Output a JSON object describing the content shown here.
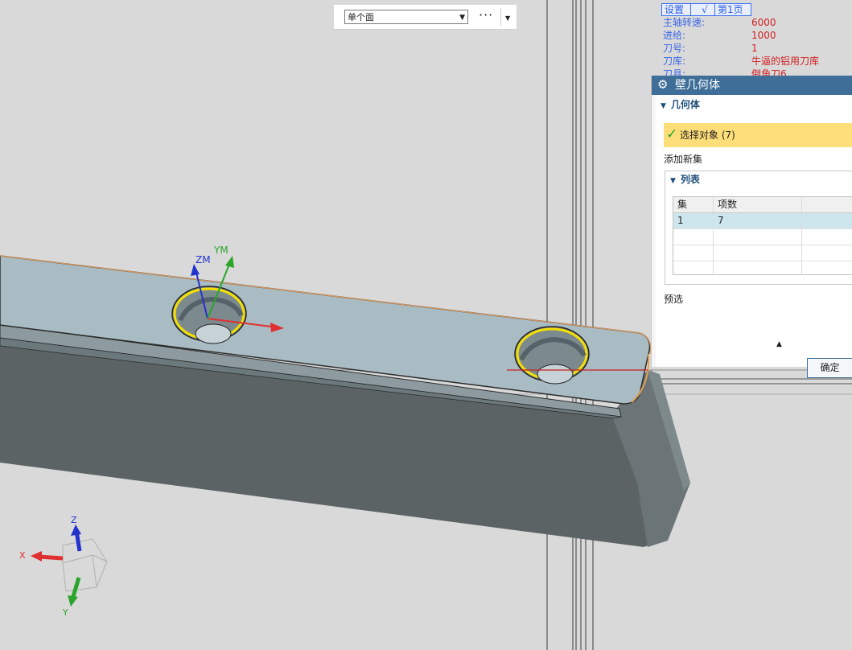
{
  "toolbar": {
    "filter_value": "单个面",
    "more_label": "···"
  },
  "info_panel": {
    "tabs": [
      "设置",
      "√",
      "第1页"
    ],
    "rows": [
      {
        "label": "主轴转速:",
        "value": "6000"
      },
      {
        "label": "进给:",
        "value": "1000"
      },
      {
        "label": "刀号:",
        "value": "1"
      },
      {
        "label": "刀库:",
        "value": "牛逼的铝用刀库"
      },
      {
        "label": "刀具:",
        "value": "倒角刀6"
      }
    ]
  },
  "dialog": {
    "title": "壁几何体",
    "geometry_section": "几何体",
    "select_object": "选择对象 (7)",
    "add_new_set": "添加新集",
    "list_section": "列表",
    "table": {
      "headers": [
        "集",
        "项数",
        ""
      ],
      "rows": [
        [
          "1",
          "7",
          ""
        ]
      ]
    },
    "preselect": "预选",
    "ok_label": "确定"
  },
  "viewport": {
    "wcs_labels": {
      "zm": "ZM",
      "ym": "YM"
    },
    "triad_labels": {
      "x": "X",
      "y": "Y",
      "z": "Z"
    }
  },
  "colors": {
    "dialog_header": "#3f6e98",
    "selection_highlight": "#fede78",
    "part_top": "#a9bcc4",
    "part_side": "#5b6364",
    "hole_edge": "#f5e000",
    "tab_border": "#3a6ff0",
    "info_value": "#d02020"
  }
}
